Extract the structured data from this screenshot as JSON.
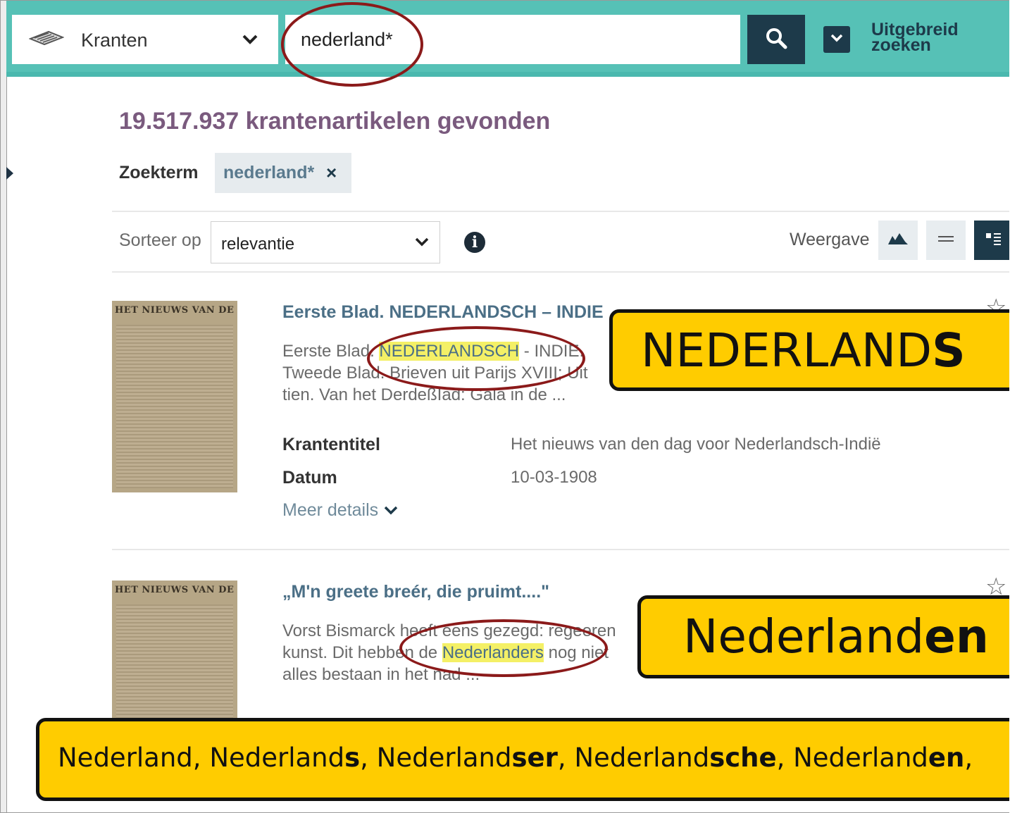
{
  "search": {
    "source_label": "Kranten",
    "query_value": "nederland*",
    "advanced_label_line1": "Uitgebreid",
    "advanced_label_line2": "zoeken"
  },
  "results_header": {
    "count_text": "19.517.937 krantenartikelen gevonden",
    "search_term_label": "Zoekterm",
    "search_term_chip": "nederland*",
    "chip_remove": "×",
    "sort_label": "Sorteer op",
    "sort_value": "relevantie",
    "view_label": "Weergave"
  },
  "results": [
    {
      "title": "Eerste Blad. NEDERLANDSCH – INDIE",
      "snippet_before": "Eerste Blad. ",
      "snippet_highlight": "NEDERLANDSCH",
      "snippet_after": " - INDIE.",
      "snippet_line2": "Tweede Blad. Brieven uit Parijs XVIII; Uit",
      "snippet_line3": "tien. Van het DerdeßIad: Gala in de ...",
      "meta_title_label": "Krantentitel",
      "meta_title_value": "Het nieuws van den dag voor Nederlandsch-Indië",
      "meta_date_label": "Datum",
      "meta_date_value": "10-03-1908",
      "more_label": "Meer details",
      "thumb_masthead": "HET NIEUWS VAN DEN DAG"
    },
    {
      "title": "„M'n greete breér, die pruimt....\"",
      "snippet_before": "Vorst Bismarck heeft eens gezegd: regeeren",
      "snippet_line2_before": "kunst. Dit hebben de ",
      "snippet_highlight": "Nederlanders",
      "snippet_line2_after": " nog niet",
      "snippet_line3": "alles bestaan in het nad ...",
      "thumb_masthead": "HET NIEUWS VAN DEN DAG"
    }
  ],
  "callouts": {
    "first_prefix": "NEDERLAND",
    "first_bold": "S",
    "second_prefix": "Nederland",
    "second_bold": "en",
    "bottom": [
      {
        "plain": "Nederland",
        "bold": ""
      },
      {
        "plain": ", Nederland",
        "bold": "s"
      },
      {
        "plain": ", Nederland",
        "bold": "ser"
      },
      {
        "plain": ", Nederland",
        "bold": "sche"
      },
      {
        "plain": ", Nederland",
        "bold": "en"
      },
      {
        "plain": ",",
        "bold": ""
      }
    ]
  },
  "colors": {
    "teal_bar": "#56c1b6",
    "navy": "#1d3a4a",
    "count_purple": "#7a5a7e",
    "highlight": "#f4f066",
    "callout_yellow": "#ffcc00",
    "ellipse_red": "#8b1a1a"
  }
}
